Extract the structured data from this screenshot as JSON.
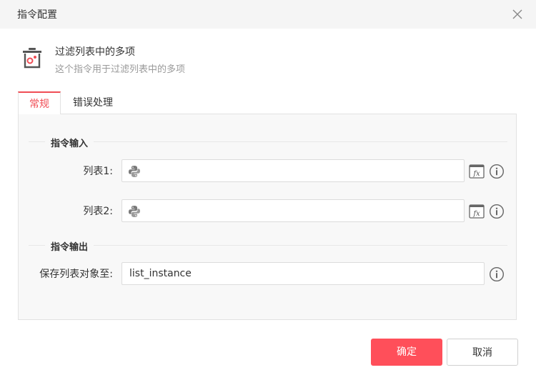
{
  "dialog": {
    "title": "指令配置"
  },
  "command": {
    "name": "过滤列表中的多项",
    "description": "这个指令用于过滤列表中的多项"
  },
  "tabs": [
    {
      "label": "常规",
      "active": true
    },
    {
      "label": "错误处理",
      "active": false
    }
  ],
  "input_section": {
    "title": "指令输入",
    "fields": [
      {
        "label": "列表1:",
        "value": ""
      },
      {
        "label": "列表2:",
        "value": ""
      }
    ]
  },
  "output_section": {
    "title": "指令输出",
    "fields": [
      {
        "label": "保存列表对象至:",
        "value": "list_instance"
      }
    ]
  },
  "buttons": {
    "ok": "确定",
    "cancel": "取消"
  },
  "colors": {
    "accent": "#ff4f5a",
    "tab_active": "#f04d55"
  },
  "icons": [
    "close-icon",
    "list-filter-icon",
    "python-icon",
    "fx-icon",
    "info-icon"
  ]
}
